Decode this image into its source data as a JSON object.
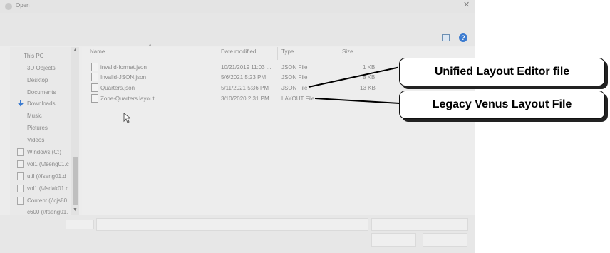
{
  "window": {
    "title": "Open",
    "close_glyph": "✕"
  },
  "toolbar": {
    "help_glyph": "?"
  },
  "nav": {
    "items": [
      {
        "label": "This PC",
        "icon": "computer-icon"
      },
      {
        "label": "3D Objects",
        "icon": "folder-icon"
      },
      {
        "label": "Desktop",
        "icon": "folder-icon"
      },
      {
        "label": "Documents",
        "icon": "folder-icon"
      },
      {
        "label": "Downloads",
        "icon": "download-arrow-icon",
        "selected": true
      },
      {
        "label": "Music",
        "icon": "folder-icon"
      },
      {
        "label": "Pictures",
        "icon": "folder-icon"
      },
      {
        "label": "Videos",
        "icon": "folder-icon"
      },
      {
        "label": "Windows (C:)",
        "icon": "drive-icon"
      },
      {
        "label": "vol1 (\\\\fseng01.c",
        "icon": "network-drive-icon"
      },
      {
        "label": "util (\\\\fseng01.d",
        "icon": "network-drive-icon"
      },
      {
        "label": "vol1 (\\\\fsdak01.c",
        "icon": "network-drive-icon"
      },
      {
        "label": "Content (\\\\cjs80",
        "icon": "network-drive-icon"
      },
      {
        "label": "c600 (\\\\fseng01.",
        "icon": "network-drive-icon"
      }
    ]
  },
  "columns": {
    "name": "Name",
    "date": "Date modified",
    "type": "Type",
    "size": "Size"
  },
  "files": [
    {
      "name": "invalid-format.json",
      "date": "10/21/2019 11:03 ...",
      "type": "JSON File",
      "size": "1 KB"
    },
    {
      "name": "Invalid-JSON.json",
      "date": "5/6/2021 5:23 PM",
      "type": "JSON File",
      "size": "8 KB"
    },
    {
      "name": "Quarters.json",
      "date": "5/11/2021 5:36 PM",
      "type": "JSON File",
      "size": "13 KB"
    },
    {
      "name": "Zone-Quarters.layout",
      "date": "3/10/2020 2:31 PM",
      "type": "LAYOUT File",
      "size": ""
    }
  ],
  "callouts": {
    "unified": "Unified Layout Editor file",
    "legacy": "Legacy Venus Layout File"
  },
  "colors": {
    "accent": "#3b7bd0",
    "callout_border": "#111111"
  }
}
